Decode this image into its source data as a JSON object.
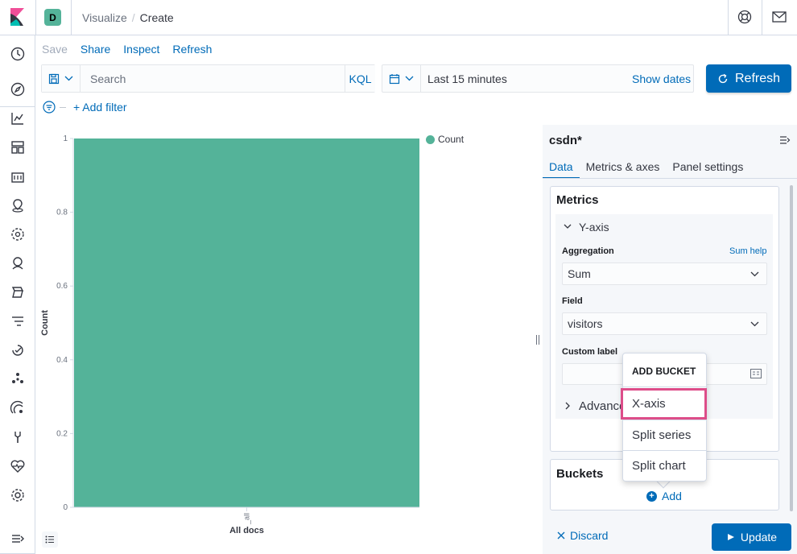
{
  "header": {
    "space_initial": "D",
    "breadcrumbs": [
      "Visualize",
      "Create"
    ],
    "breadcrumb_sep": "/"
  },
  "top_menu": {
    "items": [
      "Save",
      "Share",
      "Inspect",
      "Refresh"
    ]
  },
  "query_bar": {
    "placeholder": "Search",
    "language": "KQL"
  },
  "date_picker": {
    "range_label": "Last 15 minutes",
    "show_dates_label": "Show dates"
  },
  "refresh_button": {
    "label": "Refresh"
  },
  "filters": {
    "add_filter_label": "+ Add filter"
  },
  "chart_data": {
    "type": "bar",
    "categories": [
      "All docs"
    ],
    "series": [
      {
        "name": "Count",
        "values": [
          1
        ],
        "color": "#54b399"
      }
    ],
    "ylabel": "Count",
    "xlabel": "",
    "ylim": [
      0,
      1
    ],
    "yticks": [
      "0",
      "0.2",
      "0.4",
      "0.6",
      "0.8",
      "1"
    ],
    "xtick_axis_text": "_all",
    "legend_position": "top-right"
  },
  "legend": {
    "label": "Count",
    "color": "#54b399"
  },
  "sidebar": {
    "vis_title": "csdn*",
    "tabs": [
      "Data",
      "Metrics & axes",
      "Panel settings"
    ],
    "metrics": {
      "title": "Metrics",
      "yaxis_label": "Y-axis",
      "aggregation_label": "Aggregation",
      "sum_help_label": "Sum help",
      "aggregation_value": "Sum",
      "field_label": "Field",
      "field_value": "visitors",
      "custom_label_label": "Custom label",
      "advanced_label": "Advanced"
    },
    "buckets": {
      "title": "Buckets",
      "add_label": "Add"
    },
    "footer": {
      "discard_label": "Discard",
      "update_label": "Update"
    }
  },
  "add_bucket_popover": {
    "title": "ADD BUCKET",
    "items": [
      "X-axis",
      "Split series",
      "Split chart"
    ],
    "highlight_color": "#dd4d89"
  }
}
